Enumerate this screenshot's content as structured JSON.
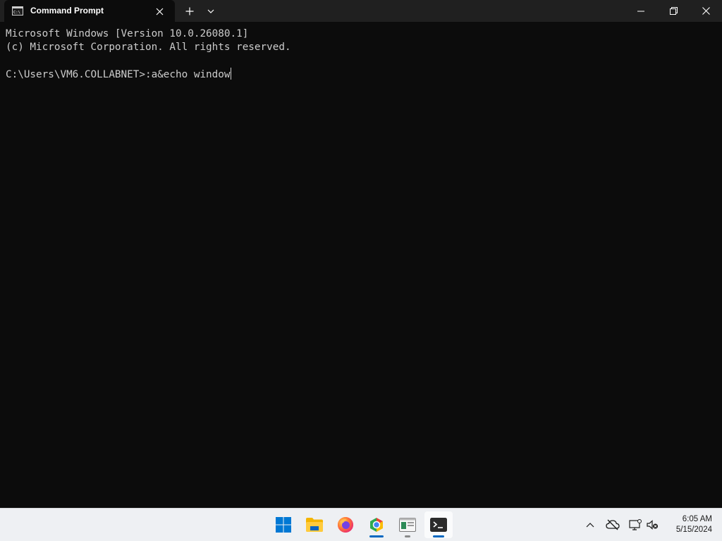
{
  "window": {
    "tab_title": "Command Prompt",
    "tab_icon": "cmd-icon",
    "close_tab_icon": "close-icon",
    "new_tab_icon": "plus-icon",
    "dropdown_icon": "chevron-down-icon",
    "minimize_icon": "minimize-icon",
    "maximize_icon": "restore-icon",
    "close_window_icon": "close-icon"
  },
  "terminal": {
    "lines": [
      "Microsoft Windows [Version 10.0.26080.1]",
      "(c) Microsoft Corporation. All rights reserved."
    ],
    "prompt": "C:\\Users\\VM6.COLLABNET>",
    "input": ":a&echo window",
    "text_color": "#cccccc",
    "background": "#0c0c0c"
  },
  "taskbar": {
    "apps": [
      {
        "name": "start-button",
        "icon": "windows-logo-icon"
      },
      {
        "name": "file-explorer",
        "icon": "folder-icon"
      },
      {
        "name": "firefox",
        "icon": "firefox-icon"
      },
      {
        "name": "chrome",
        "icon": "chrome-icon"
      },
      {
        "name": "app",
        "icon": "app-window-icon"
      },
      {
        "name": "terminal",
        "icon": "terminal-icon"
      }
    ],
    "tray": {
      "show_hidden_icon": "chevron-up-icon",
      "onedrive_icon": "cloud-offline-icon",
      "network_icon": "network-icon",
      "volume_icon": "volume-mute-icon"
    },
    "clock": {
      "time": "6:05 AM",
      "date": "5/15/2024"
    },
    "accent": "#0067c0"
  }
}
